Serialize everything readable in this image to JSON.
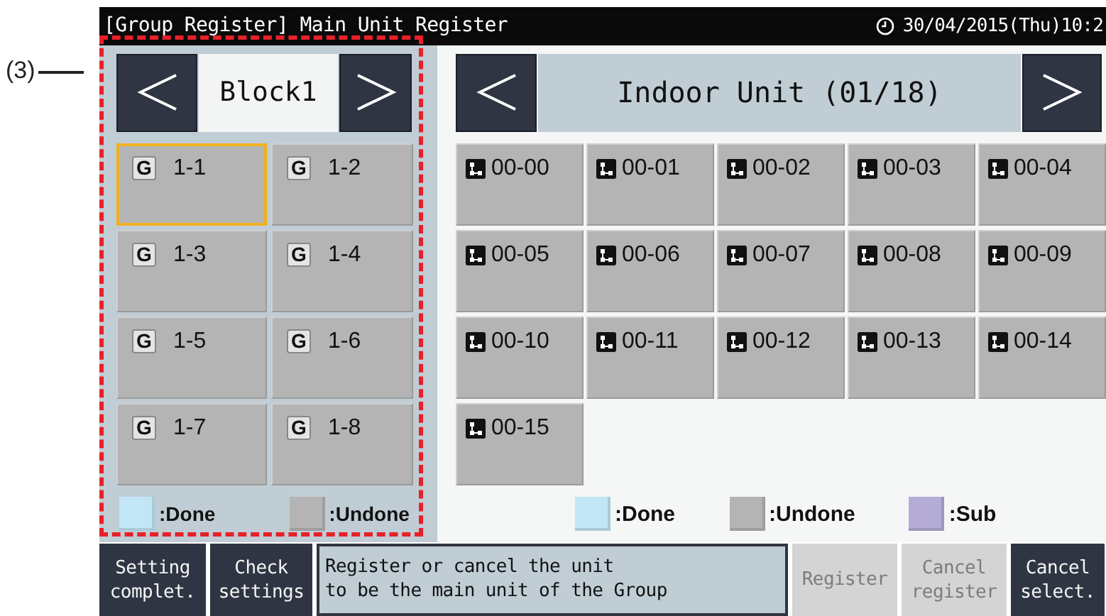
{
  "annotation": {
    "label": "(3)"
  },
  "title_bar": {
    "title": "[Group Register] Main Unit Register",
    "datetime": "30/04/2015(Thu)10:2"
  },
  "group_panel": {
    "block": "Block1",
    "groups": [
      {
        "icon": "G",
        "label": "1-1",
        "selected": true
      },
      {
        "icon": "G",
        "label": "1-2",
        "selected": false
      },
      {
        "icon": "G",
        "label": "1-3",
        "selected": false
      },
      {
        "icon": "G",
        "label": "1-4",
        "selected": false
      },
      {
        "icon": "G",
        "label": "1-5",
        "selected": false
      },
      {
        "icon": "G",
        "label": "1-6",
        "selected": false
      },
      {
        "icon": "G",
        "label": "1-7",
        "selected": false
      },
      {
        "icon": "G",
        "label": "1-8",
        "selected": false
      }
    ],
    "legend": [
      {
        "label": ":Done",
        "color": "#c2e6f6"
      },
      {
        "label": ":Undone",
        "color": "#b4b4b4"
      }
    ]
  },
  "unit_panel": {
    "title": "Indoor Unit (01/18)",
    "units": [
      {
        "label": "00-00",
        "selected": false
      },
      {
        "label": "00-01",
        "selected": false
      },
      {
        "label": "00-02",
        "selected": false
      },
      {
        "label": "00-03",
        "selected": false
      },
      {
        "label": "00-04",
        "selected": false
      },
      {
        "label": "00-05",
        "selected": false
      },
      {
        "label": "00-06",
        "selected": false
      },
      {
        "label": "00-07",
        "selected": false
      },
      {
        "label": "00-08",
        "selected": false
      },
      {
        "label": "00-09",
        "selected": false
      },
      {
        "label": "00-10",
        "selected": false
      },
      {
        "label": "00-11",
        "selected": false
      },
      {
        "label": "00-12",
        "selected": false
      },
      {
        "label": "00-13",
        "selected": false
      },
      {
        "label": "00-14",
        "selected": false
      },
      {
        "label": "00-15",
        "selected": false
      }
    ],
    "legend": [
      {
        "label": ":Done",
        "color": "#c2e6f6"
      },
      {
        "label": ":Undone",
        "color": "#b4b4b4"
      },
      {
        "label": ":Sub",
        "color": "#b4acd6"
      }
    ]
  },
  "bottom_bar": [
    {
      "kind": "button",
      "label": "Setting\ncomplet.",
      "disabled": false
    },
    {
      "kind": "button",
      "label": "Check\nsettings",
      "disabled": false
    },
    {
      "kind": "message",
      "label": "Register or cancel the unit\nto be the main unit of the Group"
    },
    {
      "kind": "button",
      "label": "Register",
      "disabled": true
    },
    {
      "kind": "button",
      "label": "Cancel\nregister",
      "disabled": true
    },
    {
      "kind": "button",
      "label": "Cancel\nselect.",
      "disabled": false
    }
  ]
}
